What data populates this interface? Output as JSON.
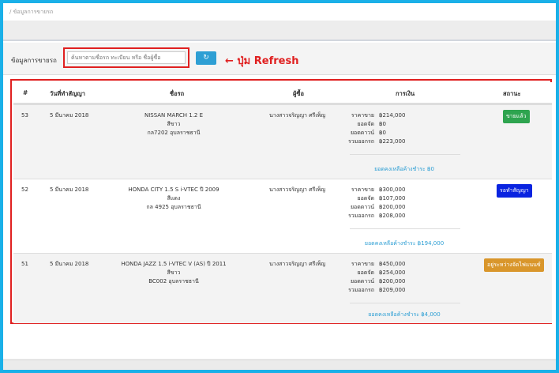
{
  "breadcrumb": "/ ข้อมูลการขายรถ",
  "filter": {
    "label": "ข้อมูลการขายรถ",
    "search_placeholder": "ค้นหาตามชื่อรถ ทะเบียน หรือ ชื่อผู้ซื้อ",
    "refresh_icon": "↻",
    "annotation": "←  ปุ่ม Refresh"
  },
  "colors": {
    "accent": "#1ab0e8",
    "annotation_red": "#e02020",
    "status_sold": "#2ea44f",
    "status_contract": "#0a24e0",
    "status_inprogress": "#d9962b",
    "balance_link": "#2e9fd4"
  },
  "table": {
    "headers": [
      "#",
      "วันที่ทำสัญญา",
      "ชื่อรถ",
      "ผู้ซื้อ",
      "การเงิน",
      "สถานะ"
    ],
    "finance_labels": [
      "ราคาขาย",
      "ยอดจัด",
      "ยอดดาวน์",
      "รวมออกรถ"
    ],
    "rows": [
      {
        "id": "53",
        "date": "5 มีนาคม 2018",
        "car_name": "NISSAN MARCH 1.2 E",
        "car_color": "สีขาว",
        "car_plate": "กล7202   อุบลราชธานี",
        "buyer": "นางสาวจริญญา    ศรีเพ็ญ",
        "price": "฿214,000",
        "financed": "฿0",
        "down": "฿0",
        "total": "฿223,000",
        "balance": "ยอดคงเหลือค้างชำระ ฿0",
        "status": "ขายแล้ว"
      },
      {
        "id": "52",
        "date": "5 มีนาคม 2018",
        "car_name": "HONDA CITY 1.5 S i-VTEC ปี 2009",
        "car_color": "สีแดง",
        "car_plate": "กล 4925   อุบลราชธานี",
        "buyer": "นางสาวจริญญา    ศรีเพ็ญ",
        "price": "฿300,000",
        "financed": "฿107,000",
        "down": "฿200,000",
        "total": "฿208,000",
        "balance": "ยอดคงเหลือค้างชำระ ฿194,000",
        "status": "รอทำสัญญา"
      },
      {
        "id": "51",
        "date": "5 มีนาคม 2018",
        "car_name": "HONDA JAZZ 1.5 i-VTEC V (AS) ปี 2011",
        "car_color": "สีขาว",
        "car_plate": "BC002   อุบลราชธานี",
        "buyer": "นางสาวจริญญา    ศรีเพ็ญ",
        "price": "฿450,000",
        "financed": "฿254,000",
        "down": "฿200,000",
        "total": "฿209,000",
        "balance": "ยอดคงเหลือค้างชำระ ฿4,000",
        "status": "อยู่ระหว่างจัดไฟแนนซ์"
      }
    ]
  }
}
